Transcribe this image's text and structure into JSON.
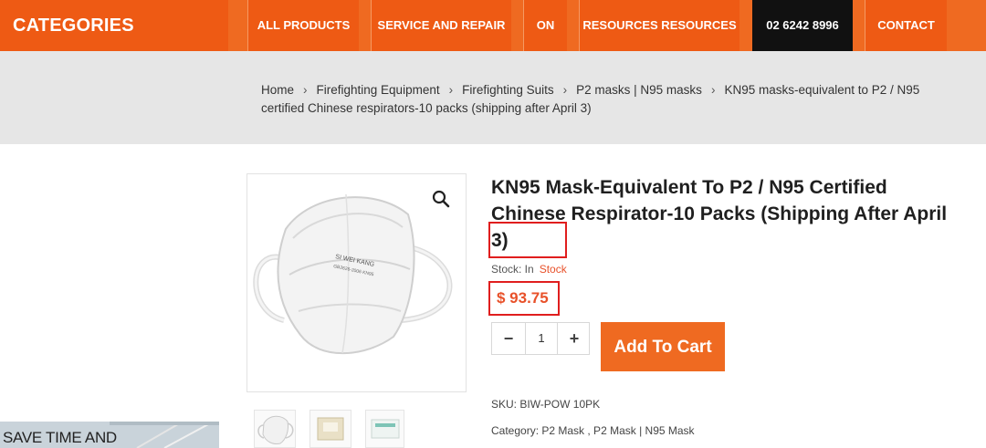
{
  "header": {
    "brand": "CATEGORIES",
    "nav": [
      "ALL PRODUCTS",
      "SERVICE AND REPAIR",
      "ON",
      "RESOURCES RESOURCES",
      "02 6242 8996",
      "CONTACT"
    ]
  },
  "breadcrumb": {
    "items": [
      "Home",
      "Firefighting Equipment",
      "Firefighting Suits",
      "P2 masks | N95 masks",
      "KN95 masks-equivalent to P2 / N95 certified Chinese respirators-10 packs (shipping after April 3)"
    ],
    "separator": "›"
  },
  "product": {
    "title": "KN95 Mask-Equivalent To P2 / N95 Certified Chinese Respirator-10 Packs (Shipping After April 3)",
    "stock_label": "Stock: In",
    "stock_value": "Stock",
    "price": "$ 93.75",
    "quantity": "1",
    "add_to_cart": "Add To Cart",
    "sku_label": "SKU:",
    "sku": "BIW-POW 10PK",
    "category_label": "Category:",
    "categories": "P2 Mask , P2 Mask | N95 Mask",
    "mask_print_brand": "SI WEI KANG",
    "mask_print_code": "GB2626-2006 KN95"
  },
  "promo": {
    "text": "SAVE TIME AND"
  },
  "icons": {
    "zoom": "search-icon",
    "minus": "minus-icon",
    "plus": "plus-icon"
  },
  "colors": {
    "accent": "#ef6a21",
    "price": "#e8512a",
    "highlight": "#e01e1e"
  }
}
